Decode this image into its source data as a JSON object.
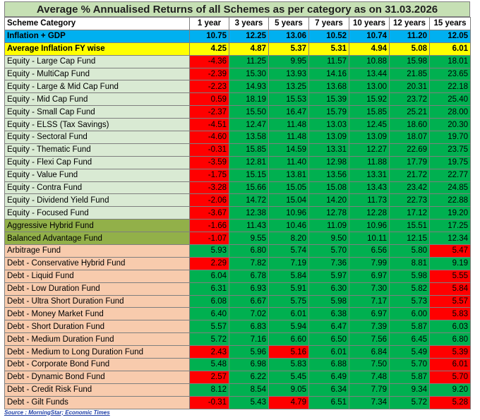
{
  "title": "Average % Annualised Returns of all Schemes as per category as on 31.03.2026",
  "headers": [
    "Scheme Category",
    "1 year",
    "3 years",
    "5 years",
    "7 years",
    "10 years",
    "12 years",
    "15 years"
  ],
  "inflation_gdp": {
    "label": "Inflation + GDP",
    "values": [
      "10.75",
      "12.25",
      "13.06",
      "10.52",
      "10.74",
      "11.20",
      "12.05"
    ]
  },
  "avg_inflation": {
    "label": "Average Inflation FY wise",
    "values": [
      "4.25",
      "4.87",
      "5.37",
      "5.31",
      "4.94",
      "5.08",
      "6.01"
    ]
  },
  "rows": [
    {
      "label": "Equity - Large Cap Fund",
      "group": "eq",
      "values": [
        "-4.36",
        "11.25",
        "9.95",
        "11.57",
        "10.88",
        "15.98",
        "18.01"
      ],
      "colors": [
        "r",
        "g",
        "g",
        "g",
        "g",
        "g",
        "g"
      ]
    },
    {
      "label": "Equity - MultiCap Fund",
      "group": "eq",
      "values": [
        "-2.39",
        "15.30",
        "13.93",
        "14.16",
        "13.44",
        "21.85",
        "23.65"
      ],
      "colors": [
        "r",
        "g",
        "g",
        "g",
        "g",
        "g",
        "g"
      ]
    },
    {
      "label": "Equity - Large & Mid Cap Fund",
      "group": "eq",
      "values": [
        "-2.23",
        "14.93",
        "13.25",
        "13.68",
        "13.00",
        "20.31",
        "22.18"
      ],
      "colors": [
        "r",
        "g",
        "g",
        "g",
        "g",
        "g",
        "g"
      ]
    },
    {
      "label": "Equity - Mid Cap Fund",
      "group": "eq",
      "values": [
        "0.59",
        "18.19",
        "15.53",
        "15.39",
        "15.92",
        "23.72",
        "25.40"
      ],
      "colors": [
        "r",
        "g",
        "g",
        "g",
        "g",
        "g",
        "g"
      ]
    },
    {
      "label": "Equity - Small Cap Fund",
      "group": "eq",
      "values": [
        "-2.37",
        "15.50",
        "16.47",
        "15.79",
        "15.85",
        "25.21",
        "28.00"
      ],
      "colors": [
        "r",
        "g",
        "g",
        "g",
        "g",
        "g",
        "g"
      ]
    },
    {
      "label": "Equity - ELSS (Tax Savings)",
      "group": "eq",
      "values": [
        "-4.51",
        "12.47",
        "11.48",
        "13.03",
        "12.45",
        "18.60",
        "20.30"
      ],
      "colors": [
        "r",
        "g",
        "g",
        "g",
        "g",
        "g",
        "g"
      ]
    },
    {
      "label": "Equity - Sectoral Fund",
      "group": "eq",
      "values": [
        "-4.60",
        "13.58",
        "11.48",
        "13.09",
        "13.09",
        "18.07",
        "19.70"
      ],
      "colors": [
        "r",
        "g",
        "g",
        "g",
        "g",
        "g",
        "g"
      ]
    },
    {
      "label": "Equity - Thematic Fund",
      "group": "eq",
      "values": [
        "-0.31",
        "15.85",
        "14.59",
        "13.31",
        "12.27",
        "22.69",
        "23.75"
      ],
      "colors": [
        "r",
        "g",
        "g",
        "g",
        "g",
        "g",
        "g"
      ]
    },
    {
      "label": "Equity - Flexi Cap Fund",
      "group": "eq",
      "values": [
        "-3.59",
        "12.81",
        "11.40",
        "12.98",
        "11.88",
        "17.79",
        "19.75"
      ],
      "colors": [
        "r",
        "g",
        "g",
        "g",
        "g",
        "g",
        "g"
      ]
    },
    {
      "label": "Equity - Value Fund",
      "group": "eq",
      "values": [
        "-1.75",
        "15.15",
        "13.81",
        "13.56",
        "13.31",
        "21.72",
        "22.77"
      ],
      "colors": [
        "r",
        "g",
        "g",
        "g",
        "g",
        "g",
        "g"
      ]
    },
    {
      "label": "Equity - Contra Fund",
      "group": "eq",
      "values": [
        "-3.28",
        "15.66",
        "15.05",
        "15.08",
        "13.43",
        "23.42",
        "24.85"
      ],
      "colors": [
        "r",
        "g",
        "g",
        "g",
        "g",
        "g",
        "g"
      ]
    },
    {
      "label": "Equity - Dividend Yield Fund",
      "group": "eq",
      "values": [
        "-2.06",
        "14.72",
        "15.04",
        "14.20",
        "11.73",
        "22.73",
        "22.88"
      ],
      "colors": [
        "r",
        "g",
        "g",
        "g",
        "g",
        "g",
        "g"
      ]
    },
    {
      "label": "Equity - Focused Fund",
      "group": "eq",
      "values": [
        "-3.67",
        "12.38",
        "10.96",
        "12.78",
        "12.28",
        "17.12",
        "19.20"
      ],
      "colors": [
        "r",
        "g",
        "g",
        "g",
        "g",
        "g",
        "g"
      ]
    },
    {
      "label": "Aggressive Hybrid Fund",
      "group": "hyb",
      "values": [
        "-1.66",
        "11.43",
        "10.46",
        "11.09",
        "10.96",
        "15.51",
        "17.25"
      ],
      "colors": [
        "r",
        "g",
        "g",
        "g",
        "g",
        "g",
        "g"
      ]
    },
    {
      "label": "Balanced Advantage Fund",
      "group": "hyb",
      "values": [
        "-1.07",
        "9.55",
        "8.20",
        "9.50",
        "10.11",
        "12.15",
        "12.34"
      ],
      "colors": [
        "r",
        "g",
        "g",
        "g",
        "g",
        "g",
        "g"
      ]
    },
    {
      "label": "Arbitrage Fund",
      "group": "debt",
      "values": [
        "5.93",
        "6.80",
        "5.74",
        "5.70",
        "6.56",
        "5.80",
        "5.47"
      ],
      "colors": [
        "g",
        "g",
        "g",
        "g",
        "g",
        "g",
        "r"
      ]
    },
    {
      "label": "Debt - Conservative Hybrid Fund",
      "group": "debt",
      "values": [
        "2.29",
        "7.82",
        "7.19",
        "7.36",
        "7.99",
        "8.81",
        "9.19"
      ],
      "colors": [
        "r",
        "g",
        "g",
        "g",
        "g",
        "g",
        "g"
      ]
    },
    {
      "label": "Debt - Liquid Fund",
      "group": "debt",
      "values": [
        "6.04",
        "6.78",
        "5.84",
        "5.97",
        "6.97",
        "5.98",
        "5.55"
      ],
      "colors": [
        "g",
        "g",
        "g",
        "g",
        "g",
        "g",
        "r"
      ]
    },
    {
      "label": "Debt - Low Duration Fund",
      "group": "debt",
      "values": [
        "6.31",
        "6.93",
        "5.91",
        "6.30",
        "7.30",
        "5.82",
        "5.84"
      ],
      "colors": [
        "g",
        "g",
        "g",
        "g",
        "g",
        "g",
        "r"
      ]
    },
    {
      "label": "Debt - Ultra Short Duration Fund",
      "group": "debt",
      "values": [
        "6.08",
        "6.67",
        "5.75",
        "5.98",
        "7.17",
        "5.73",
        "5.57"
      ],
      "colors": [
        "g",
        "g",
        "g",
        "g",
        "g",
        "g",
        "r"
      ]
    },
    {
      "label": "Debt - Money Market Fund",
      "group": "debt",
      "values": [
        "6.40",
        "7.02",
        "6.01",
        "6.38",
        "6.97",
        "6.00",
        "5.83"
      ],
      "colors": [
        "g",
        "g",
        "g",
        "g",
        "g",
        "g",
        "r"
      ]
    },
    {
      "label": "Debt - Short Duration Fund",
      "group": "debt",
      "values": [
        "5.57",
        "6.83",
        "5.94",
        "6.47",
        "7.39",
        "5.87",
        "6.03"
      ],
      "colors": [
        "g",
        "g",
        "g",
        "g",
        "g",
        "g",
        "g"
      ]
    },
    {
      "label": "Debt - Medium Duration Fund",
      "group": "debt",
      "values": [
        "5.72",
        "7.16",
        "6.60",
        "6.50",
        "7.56",
        "6.45",
        "6.80"
      ],
      "colors": [
        "g",
        "g",
        "g",
        "g",
        "g",
        "g",
        "g"
      ]
    },
    {
      "label": "Debt - Medium to Long Duration Fund",
      "group": "debt",
      "values": [
        "2.43",
        "5.96",
        "5.16",
        "6.01",
        "6.84",
        "5.49",
        "5.39"
      ],
      "colors": [
        "r",
        "g",
        "r",
        "g",
        "g",
        "g",
        "r"
      ]
    },
    {
      "label": "Debt - Corporate Bond Fund",
      "group": "debt",
      "values": [
        "5.48",
        "6.98",
        "5.83",
        "6.88",
        "7.50",
        "5.70",
        "6.01"
      ],
      "colors": [
        "g",
        "g",
        "g",
        "g",
        "g",
        "g",
        "r"
      ]
    },
    {
      "label": "Debt - Dynamic Bond Fund",
      "group": "debt",
      "values": [
        "2.57",
        "6.22",
        "5.45",
        "6.49",
        "7.48",
        "5.87",
        "5.70"
      ],
      "colors": [
        "r",
        "g",
        "g",
        "g",
        "g",
        "g",
        "r"
      ]
    },
    {
      "label": "Debt - Credit Risk Fund",
      "group": "debt",
      "values": [
        "8.12",
        "8.54",
        "9.05",
        "6.34",
        "7.79",
        "9.34",
        "9.20"
      ],
      "colors": [
        "g",
        "g",
        "g",
        "g",
        "g",
        "g",
        "g"
      ]
    },
    {
      "label": "Debt - Gilt Funds",
      "group": "debt",
      "values": [
        "-0.31",
        "5.43",
        "4.79",
        "6.51",
        "7.34",
        "5.72",
        "5.28"
      ],
      "colors": [
        "r",
        "g",
        "r",
        "g",
        "g",
        "g",
        "r"
      ]
    }
  ],
  "source": "Source : MorningStar; Economic Times",
  "colors": {
    "positive": "#00b050",
    "negative": "#ff0000",
    "inflation_row": "#00b0f0",
    "avg_inflation_row": "#ffff00",
    "equity": "#d9ead3",
    "hybrid": "#92b049",
    "debt": "#f8cbad"
  }
}
